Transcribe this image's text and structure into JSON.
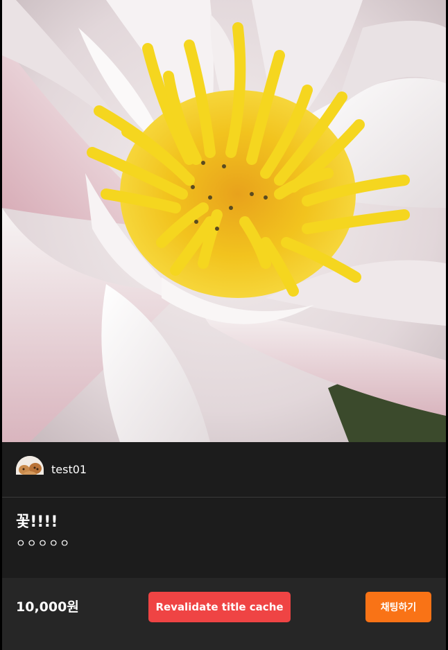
{
  "product": {
    "image_alt": "white and pink water lily with yellow stamens",
    "seller_name": "test01",
    "title": "꽃!!!!",
    "description": "ㅇㅇㅇㅇㅇ",
    "price": "10,000원"
  },
  "actions": {
    "revalidate_label": "Revalidate title cache",
    "chat_label": "채팅하기"
  },
  "colors": {
    "background": "#1c1c1c",
    "footer": "#262626",
    "revalidate_button": "#ef4444",
    "chat_button": "#f97316"
  },
  "icons": {
    "avatar": "seller-avatar-image"
  }
}
